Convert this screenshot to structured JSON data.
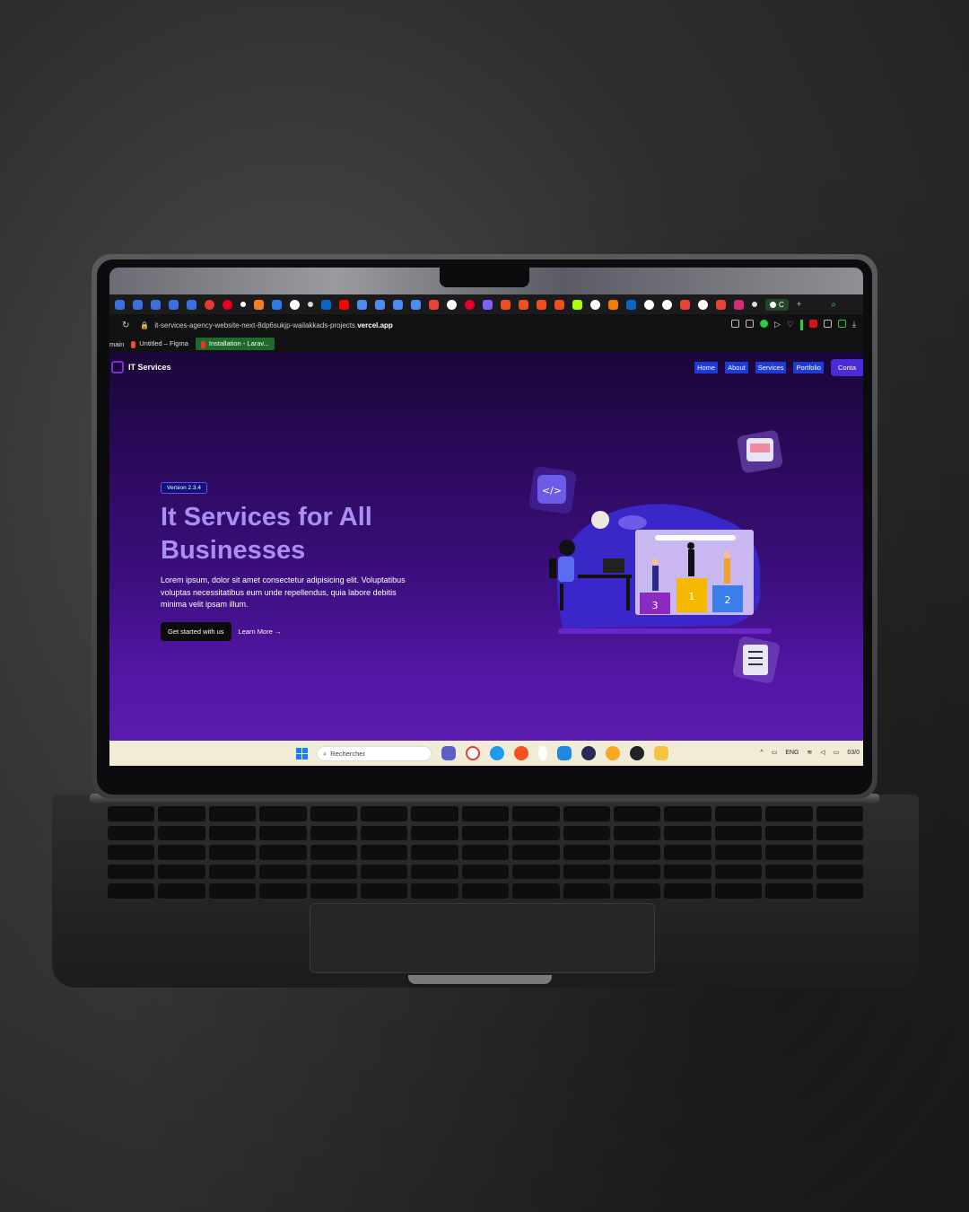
{
  "browser": {
    "url_prefix": "it-services-agency-website-next-8dp6sukjp-wailakkads-projects.",
    "url_domain": "vercel.app",
    "active_tab_label": "C",
    "bookmarks": {
      "partial_left": "main",
      "figma": "Untitled – Figma",
      "laravel": "Installation - Larav..."
    }
  },
  "site": {
    "brand": "IT Services",
    "nav": {
      "home": "Home",
      "about": "About",
      "services": "Services",
      "portfolio": "Portfolio",
      "contact": "Conta"
    },
    "version_badge": "Version 2.3.4",
    "title": "It Services for All Businesses",
    "description": "Lorem ipsum, dolor sit amet consectetur adipisicing elit. Voluptatibus voluptas necessitatibus eum unde repellendus, quia labore debitis minima velit ipsam illum.",
    "cta_primary": "Get started with us",
    "cta_secondary": "Learn More →",
    "podium": {
      "first": "1",
      "second": "2",
      "third": "3"
    }
  },
  "taskbar": {
    "search_placeholder": "Rechercher",
    "language": "ENG",
    "date_partial": "03/0"
  },
  "colors": {
    "hero_title": "#a98ff5",
    "nav_link_bg": "#1d3bd9",
    "contact_bg": "#4b2ad8",
    "site_bg_top": "#1a0638",
    "site_bg_bottom": "#5b1cae"
  }
}
